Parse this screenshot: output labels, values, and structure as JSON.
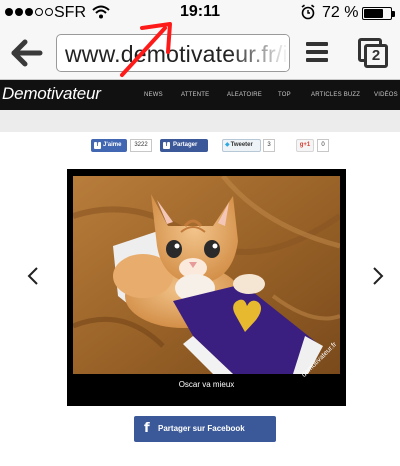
{
  "status_bar": {
    "carrier": "SFR",
    "time": "19:11",
    "battery_percent": "72 %",
    "battery_level": 0.72,
    "signal_bars_filled": 3,
    "signal_bars_total": 5
  },
  "browser": {
    "url": "www.demotivateur.fr/ima",
    "tab_count": "2"
  },
  "site": {
    "logo": "Demotivateur",
    "nav": [
      "NEWS",
      "ATTENTE",
      "ALEATOIRE",
      "TOP",
      "ARTICLES BUZZ",
      "VIDÉOS"
    ]
  },
  "share": {
    "fb_like_label": "J'aime",
    "fb_like_count": "3222",
    "fb_share_label": "Partager",
    "tweet_label": "Tweeter",
    "tweet_count": "3",
    "gplus_label": "g+1",
    "gplus_count": "0"
  },
  "post": {
    "caption": "Oscar va mieux",
    "watermark": "demotivateur.fr"
  },
  "cta": {
    "label": "Partager sur Facebook",
    "glyph": "f"
  },
  "colors": {
    "facebook_blue": "#3b5998",
    "annotation_red": "#ff1a1a"
  }
}
